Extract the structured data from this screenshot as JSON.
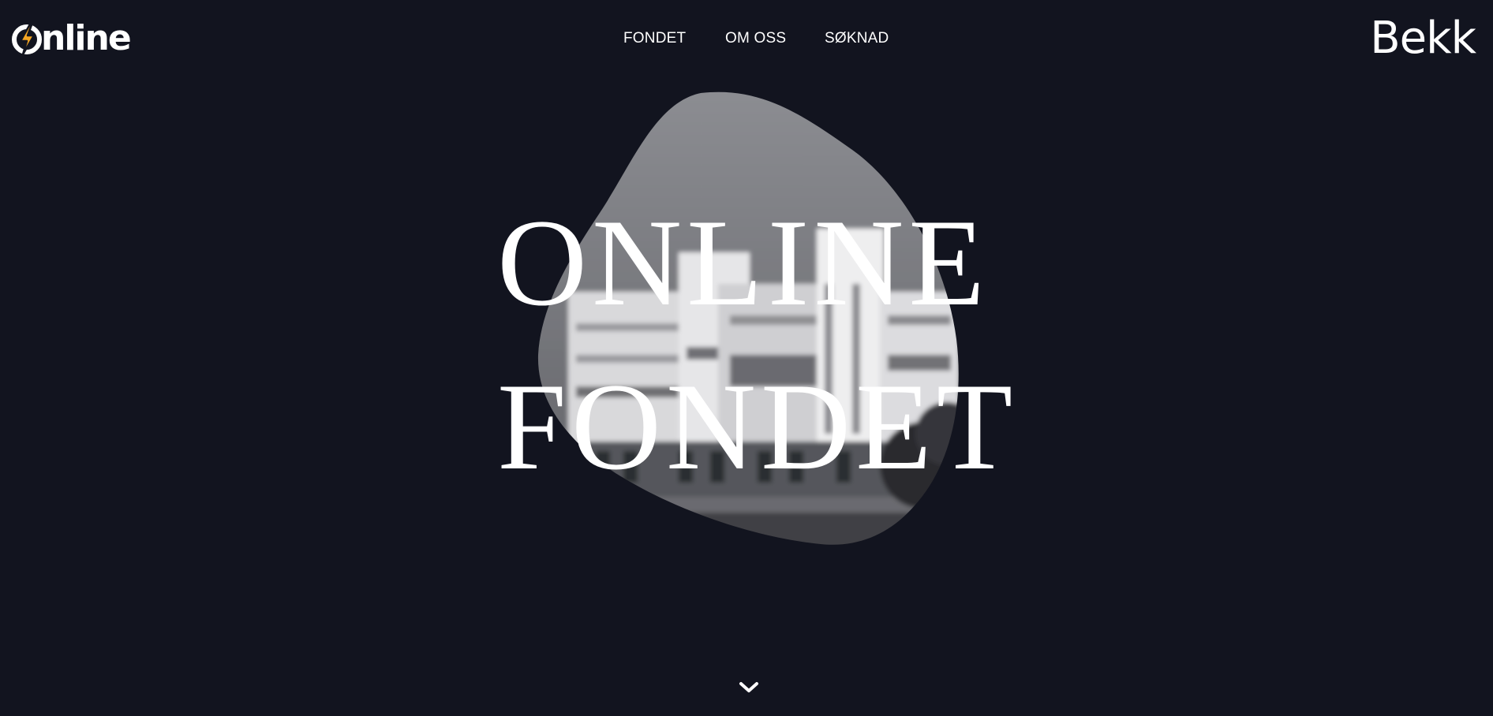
{
  "header": {
    "logo_text": "nline",
    "logo_icon": "lightning-o-icon",
    "nav": [
      {
        "label": "FONDET"
      },
      {
        "label": "OM OSS"
      },
      {
        "label": "SØKNAD"
      }
    ],
    "partner_logo": "Bekk"
  },
  "hero": {
    "title_line1": "ONLINE",
    "title_line2": "FONDET",
    "background_image": "building-photo-blob"
  },
  "scroll": {
    "icon": "chevron-down-icon"
  },
  "colors": {
    "background": "#12141f",
    "text": "#ffffff",
    "accent": "#f5a623"
  }
}
